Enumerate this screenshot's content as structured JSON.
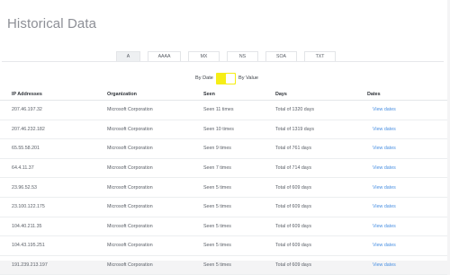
{
  "page": {
    "title": "Historical Data"
  },
  "tabs": [
    {
      "label": "A",
      "active": true
    },
    {
      "label": "AAAA",
      "active": false
    },
    {
      "label": "MX",
      "active": false
    },
    {
      "label": "NS",
      "active": false
    },
    {
      "label": "SOA",
      "active": false
    },
    {
      "label": "TXT",
      "active": false
    }
  ],
  "toggle": {
    "left_label": "By Date",
    "right_label": "By Value",
    "color": "#f6ee16"
  },
  "table": {
    "columns": [
      "IP Addresses",
      "Organization",
      "Seen",
      "Days",
      "Dates"
    ],
    "rows": [
      {
        "ip": "207.46.197.32",
        "org": "Microsoft Corporation",
        "seen": "Seen 11 times",
        "days": "Total of 1320 days",
        "link": "View dates"
      },
      {
        "ip": "207.46.232.182",
        "org": "Microsoft Corporation",
        "seen": "Seen 10 times",
        "days": "Total of 1319 days",
        "link": "View dates"
      },
      {
        "ip": "65.55.58.201",
        "org": "Microsoft Corporation",
        "seen": "Seen 9 times",
        "days": "Total of 761 days",
        "link": "View dates"
      },
      {
        "ip": "64.4.11.37",
        "org": "Microsoft Corporation",
        "seen": "Seen 7 times",
        "days": "Total of 714 days",
        "link": "View dates"
      },
      {
        "ip": "23.96.52.53",
        "org": "Microsoft Corporation",
        "seen": "Seen 5 times",
        "days": "Total of 609 days",
        "link": "View dates"
      },
      {
        "ip": "23.100.122.175",
        "org": "Microsoft Corporation",
        "seen": "Seen 5 times",
        "days": "Total of 609 days",
        "link": "View dates"
      },
      {
        "ip": "104.40.211.35",
        "org": "Microsoft Corporation",
        "seen": "Seen 5 times",
        "days": "Total of 609 days",
        "link": "View dates"
      },
      {
        "ip": "104.43.195.251",
        "org": "Microsoft Corporation",
        "seen": "Seen 5 times",
        "days": "Total of 609 days",
        "link": "View dates"
      },
      {
        "ip": "191.239.213.197",
        "org": "Microsoft Corporation",
        "seen": "Seen 5 times",
        "days": "Total of 609 days",
        "link": "View dates"
      }
    ]
  },
  "colors": {
    "link": "#4a90e2",
    "title": "#8d8f96"
  }
}
